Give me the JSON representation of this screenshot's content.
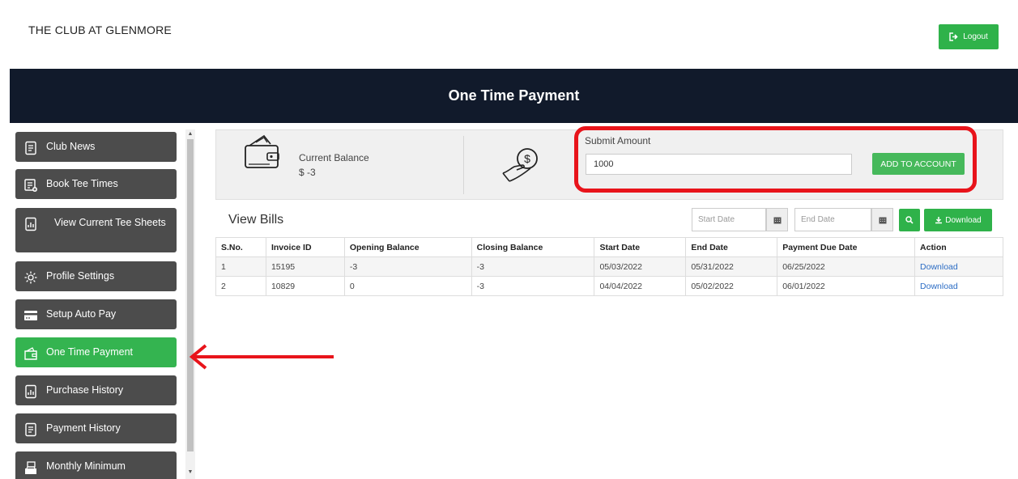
{
  "header": {
    "club_name": "THE CLUB AT GLENMORE",
    "logout_label": "Logout",
    "page_title": "One Time Payment"
  },
  "sidebar": {
    "items": [
      {
        "label": "Club News",
        "icon": "document-icon",
        "active": false
      },
      {
        "label": "Book Tee Times",
        "icon": "calendar-add-icon",
        "active": false
      },
      {
        "label": "View Current Tee Sheets",
        "icon": "chart-document-icon",
        "active": false
      },
      {
        "label": "Profile Settings",
        "icon": "gear-icon",
        "active": false
      },
      {
        "label": "Setup Auto Pay",
        "icon": "credit-card-icon",
        "active": false
      },
      {
        "label": "One Time Payment",
        "icon": "wallet-icon",
        "active": true
      },
      {
        "label": "Purchase History",
        "icon": "chart-document-icon",
        "active": false
      },
      {
        "label": "Payment History",
        "icon": "document-icon",
        "active": false
      },
      {
        "label": "Monthly Minimum",
        "icon": "cash-register-icon",
        "active": false
      }
    ]
  },
  "balance": {
    "label": "Current Balance",
    "value": "$ -3"
  },
  "submit": {
    "label": "Submit Amount",
    "amount": "1000",
    "button_label": "ADD TO ACCOUNT"
  },
  "bills": {
    "title": "View Bills",
    "start_placeholder": "Start Date",
    "end_placeholder": "End Date",
    "download_label": "Download",
    "columns": [
      "S.No.",
      "Invoice ID",
      "Opening Balance",
      "Closing Balance",
      "Start Date",
      "End Date",
      "Payment Due Date",
      "Action"
    ],
    "rows": [
      [
        "1",
        "15195",
        "-3",
        "-3",
        "05/03/2022",
        "05/31/2022",
        "06/25/2022",
        "Download"
      ],
      [
        "2",
        "10829",
        "0",
        "-3",
        "04/04/2022",
        "05/02/2022",
        "06/01/2022",
        "Download"
      ]
    ]
  },
  "colors": {
    "accent_green": "#2fb24a",
    "header_navy": "#111a2b",
    "highlight_red": "#e8141b"
  }
}
